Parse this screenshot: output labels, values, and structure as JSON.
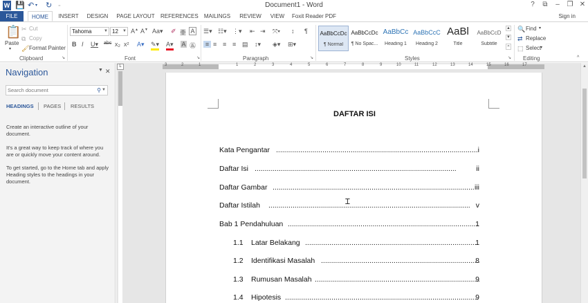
{
  "titlebar": {
    "title": "Document1 - Word",
    "help": "?",
    "restore_ribbon": "⧉",
    "minimize": "–",
    "maximize": "❐",
    "close": "✕"
  },
  "tabs": [
    "FILE",
    "HOME",
    "INSERT",
    "DESIGN",
    "PAGE LAYOUT",
    "REFERENCES",
    "MAILINGS",
    "REVIEW",
    "VIEW",
    "Foxit Reader PDF"
  ],
  "signin": "Sign in",
  "clipboard": {
    "paste": "Paste",
    "cut": "Cut",
    "copy": "Copy",
    "format_painter": "Format Painter",
    "label": "Clipboard"
  },
  "font": {
    "name": "Tahoma",
    "size": "12",
    "label": "Font"
  },
  "paragraph": {
    "label": "Paragraph"
  },
  "styles": {
    "label": "Styles",
    "items": [
      {
        "preview": "AaBbCcDc",
        "name": "¶ Normal"
      },
      {
        "preview": "AaBbCcDc",
        "name": "¶ No Spac..."
      },
      {
        "preview": "AaBbCc",
        "name": "Heading 1"
      },
      {
        "preview": "AaBbCcC",
        "name": "Heading 2"
      },
      {
        "preview": "AaBl",
        "name": "Title"
      },
      {
        "preview": "AaBbCcD",
        "name": "Subtitle"
      }
    ]
  },
  "editing": {
    "find": "Find",
    "replace": "Replace",
    "select": "Select",
    "label": "Editing"
  },
  "navigation": {
    "title": "Navigation",
    "search_placeholder": "Search document",
    "tabs": [
      "HEADINGS",
      "PAGES",
      "RESULTS"
    ],
    "help": [
      "Create an interactive outline of your document.",
      "It's a great way to keep track of where you are or quickly move your content around.",
      "To get started, go to the Home tab and apply Heading styles to the headings in your document."
    ]
  },
  "ruler": {
    "numbers": [
      "3",
      "2",
      "1",
      "1",
      "2",
      "3",
      "4",
      "5",
      "6",
      "7",
      "8",
      "9",
      "10",
      "11",
      "12",
      "13",
      "14",
      "15",
      "16",
      "17"
    ]
  },
  "document": {
    "title": "DAFTAR ISI",
    "toc": [
      {
        "num": "",
        "text": "Kata Pengantar",
        "page": "i"
      },
      {
        "num": "",
        "text": "Daftar Isi",
        "page": "ii"
      },
      {
        "num": "",
        "text": "Daftar Gambar",
        "page": "iii"
      },
      {
        "num": "",
        "text": "Daftar Istilah",
        "page": "v"
      },
      {
        "num": "",
        "text": "Bab 1 Pendahuluan",
        "page": "1"
      },
      {
        "num": "1.1",
        "text": "Latar Belakang",
        "page": "1"
      },
      {
        "num": "1.2",
        "text": "Identifikasi Masalah",
        "page": "8"
      },
      {
        "num": "1.3",
        "text": "Rumusan Masalah",
        "page": "9"
      },
      {
        "num": "1.4",
        "text": "Hipotesis",
        "page": "9"
      }
    ]
  }
}
